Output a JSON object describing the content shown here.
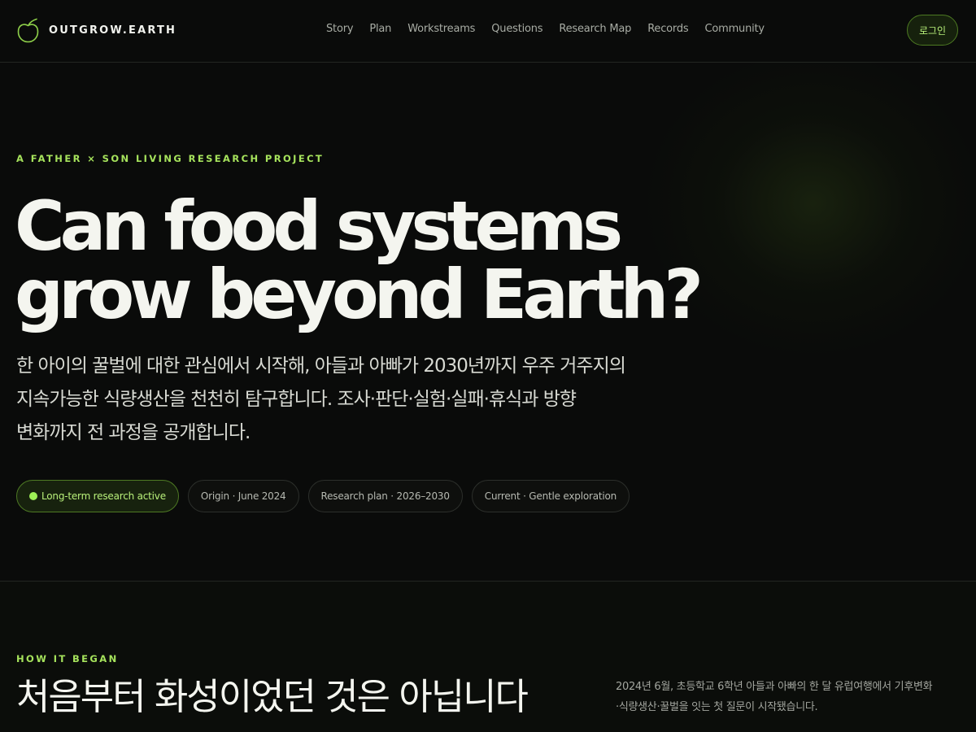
{
  "brand": {
    "name": "OUTGROW.EARTH",
    "icon": "apple-outline-icon",
    "accent": "#a6e35c"
  },
  "nav": {
    "items": [
      {
        "label": "Story"
      },
      {
        "label": "Plan"
      },
      {
        "label": "Workstreams"
      },
      {
        "label": "Questions"
      },
      {
        "label": "Research Map"
      },
      {
        "label": "Records"
      },
      {
        "label": "Community"
      }
    ],
    "login_label": "로그인"
  },
  "hero": {
    "eyebrow": "A FATHER × SON LIVING RESEARCH PROJECT",
    "title_line1": "Can food systems",
    "title_line2": "grow beyond Earth?",
    "description_lines": [
      "한 아이의 꿀벌에 대한 관심에서 시작해, 아들과 아빠가 2030년까지 우주 거주지의",
      "지속가능한 식량생산을 천천히 탐구합니다. 조사·판단·실험·실패·휴식과 방향",
      "변화까지 전 과정을 공개합니다."
    ],
    "pills": [
      {
        "label": "Long-term research active",
        "status": "active"
      },
      {
        "label": "Origin · June 2024"
      },
      {
        "label": "Research plan · 2026–2030"
      },
      {
        "label": "Current · Gentle exploration"
      }
    ]
  },
  "section_began": {
    "eyebrow": "HOW IT BEGAN",
    "title": "처음부터 화성이었던 것은 아닙니다",
    "description_lines": [
      "2024년 6월, 초등학교 6학년 아들과 아빠의 한 달 유럽여행에서 기후변화",
      "·식량생산·꿀벌을 잇는 첫 질문이 시작됐습니다."
    ]
  }
}
